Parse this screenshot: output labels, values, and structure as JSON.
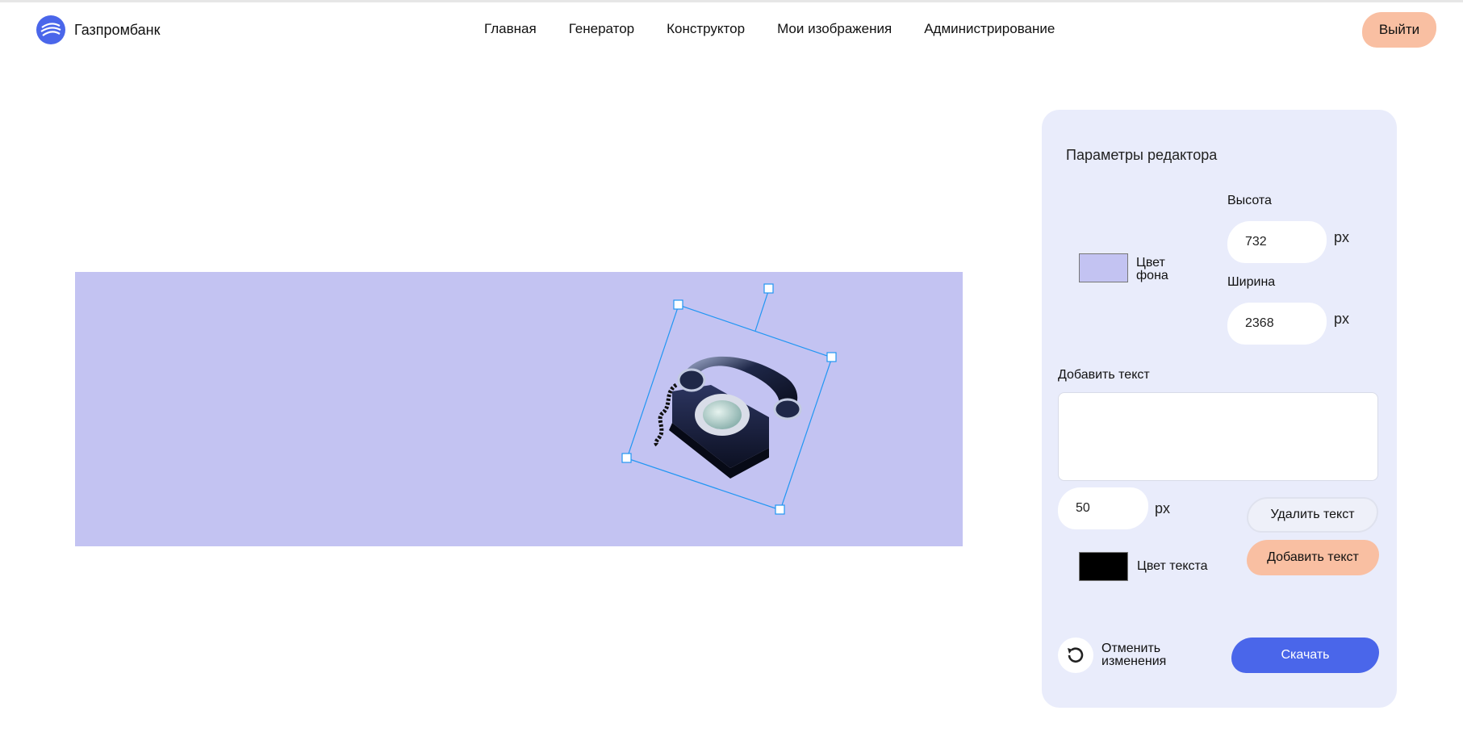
{
  "header": {
    "brand": "Газпромбанк",
    "nav": [
      "Главная",
      "Генератор",
      "Конструктор",
      "Мои изображения",
      "Администрирование"
    ],
    "logout_label": "Выйти"
  },
  "editor": {
    "background_color": "#c3c3f2",
    "image": "rotary-telephone",
    "selection_color": "#2196f3"
  },
  "panel": {
    "title": "Параметры редактора",
    "height_label": "Высота",
    "height_value": "732",
    "width_label": "Ширина",
    "width_value": "2368",
    "unit": "px",
    "bg_color_label_line1": "Цвет",
    "bg_color_label_line2": "фона",
    "bg_color": "#c3c3f2",
    "add_text_label": "Добавить текст",
    "text_value": "",
    "font_size_value": "50",
    "delete_text_label": "Удалить текст",
    "add_text_button": "Добавить текст",
    "text_color_label": "Цвет текста",
    "text_color": "#000000",
    "undo_label_line1": "Отменить",
    "undo_label_line2": "изменения",
    "download_label": "Скачать"
  },
  "colors": {
    "accent": "#4a66ea",
    "peach": "#f9bfa2",
    "panel_bg": "#e9ecfb"
  }
}
